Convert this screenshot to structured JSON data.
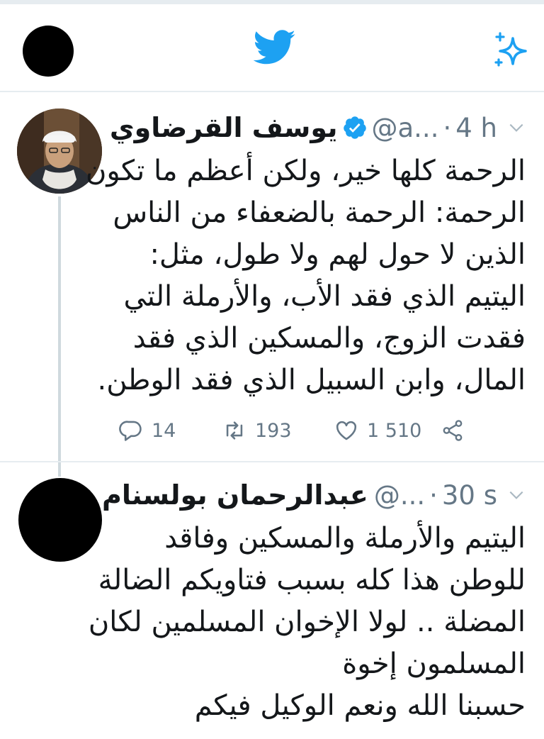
{
  "colors": {
    "twitter_blue": "#1da1f2",
    "muted": "#657786",
    "divider": "#e6ecf0"
  },
  "header": {
    "logo_icon": "twitter-bird-icon",
    "action_icon": "sparkle-icon"
  },
  "tweets": [
    {
      "name": "يوسف القرضاوي",
      "verified": true,
      "handle": "@a...",
      "time": "4 h",
      "lines": [
        "الرحمة كلها خير، ولكن أعظم ما تكون",
        "الرحمة: الرحمة بالضعفاء من الناس",
        "الذين لا حول لهم ولا طول، مثل:",
        "اليتيم الذي فقد الأب، والأرملة التي",
        "فقدت الزوج، والمسكين الذي فقد",
        "المال، وابن السبيل الذي فقد الوطن."
      ],
      "stats": {
        "replies": "14",
        "retweets": "193",
        "likes": "1 510"
      }
    },
    {
      "name": "عبدالرحمان بولسنام",
      "handle": "@...",
      "time": "30 s",
      "lines": [
        "اليتيم والأرملة والمسكين وفاقد",
        "للوطن هذا كله بسبب فتاويكم الضالة",
        "المضلة .. لولا الإخوان المسلمين لكان",
        "المسلمون إخوة",
        "حسبنا الله ونعم الوكيل فيكم"
      ]
    }
  ]
}
